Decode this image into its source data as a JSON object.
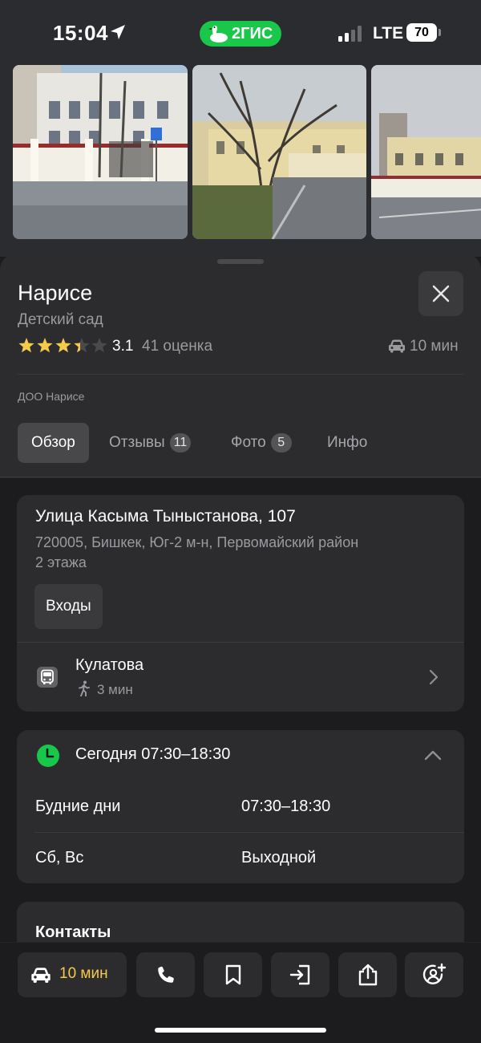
{
  "status_bar": {
    "time": "15:04",
    "brand": "2ГИС",
    "network": "LTE",
    "battery": "70"
  },
  "place": {
    "title": "Нарисе",
    "category": "Детский сад",
    "rating": "3.1",
    "rating_value": 3.1,
    "rating_count": "41 оценка",
    "drive_time": "10 мин",
    "org_name": "ДОО Нарисе"
  },
  "tabs": [
    {
      "label": "Обзор",
      "badge": ""
    },
    {
      "label": "Отзывы",
      "badge": "11"
    },
    {
      "label": "Фото",
      "badge": "5"
    },
    {
      "label": "Инфо",
      "badge": ""
    }
  ],
  "address": {
    "street": "Улица Касыма Тыныстанова, 107",
    "city_line": "720005, Бишкек, Юг-2 м-н, Первомайский район",
    "floors": "2 этажа",
    "entrances_label": "Входы"
  },
  "transit": {
    "stop": "Кулатова",
    "walk_time": "3 мин"
  },
  "hours": {
    "today": "Сегодня 07:30–18:30",
    "rows": [
      {
        "days": "Будние дни",
        "time": "07:30–18:30"
      },
      {
        "days": "Сб, Вс",
        "time": "Выходной"
      }
    ]
  },
  "contacts": {
    "title": "Контакты"
  },
  "toolbar": {
    "route_label": "10 мин"
  },
  "colors": {
    "accent_green": "#19c74a",
    "star_gold": "#f5c94b",
    "route_text": "#f5c94b",
    "background": "#1c1c1e",
    "card": "#2c2c2e"
  },
  "icons": [
    "location-arrow-icon",
    "goose-logo-icon",
    "signal-icon",
    "battery-icon",
    "close-icon",
    "star-icon",
    "car-icon",
    "bus-icon",
    "walk-icon",
    "chevron-right-icon",
    "clock-icon",
    "chevron-up-icon",
    "phone-icon",
    "bookmark-icon",
    "entrance-icon",
    "share-icon",
    "add-person-icon"
  ]
}
